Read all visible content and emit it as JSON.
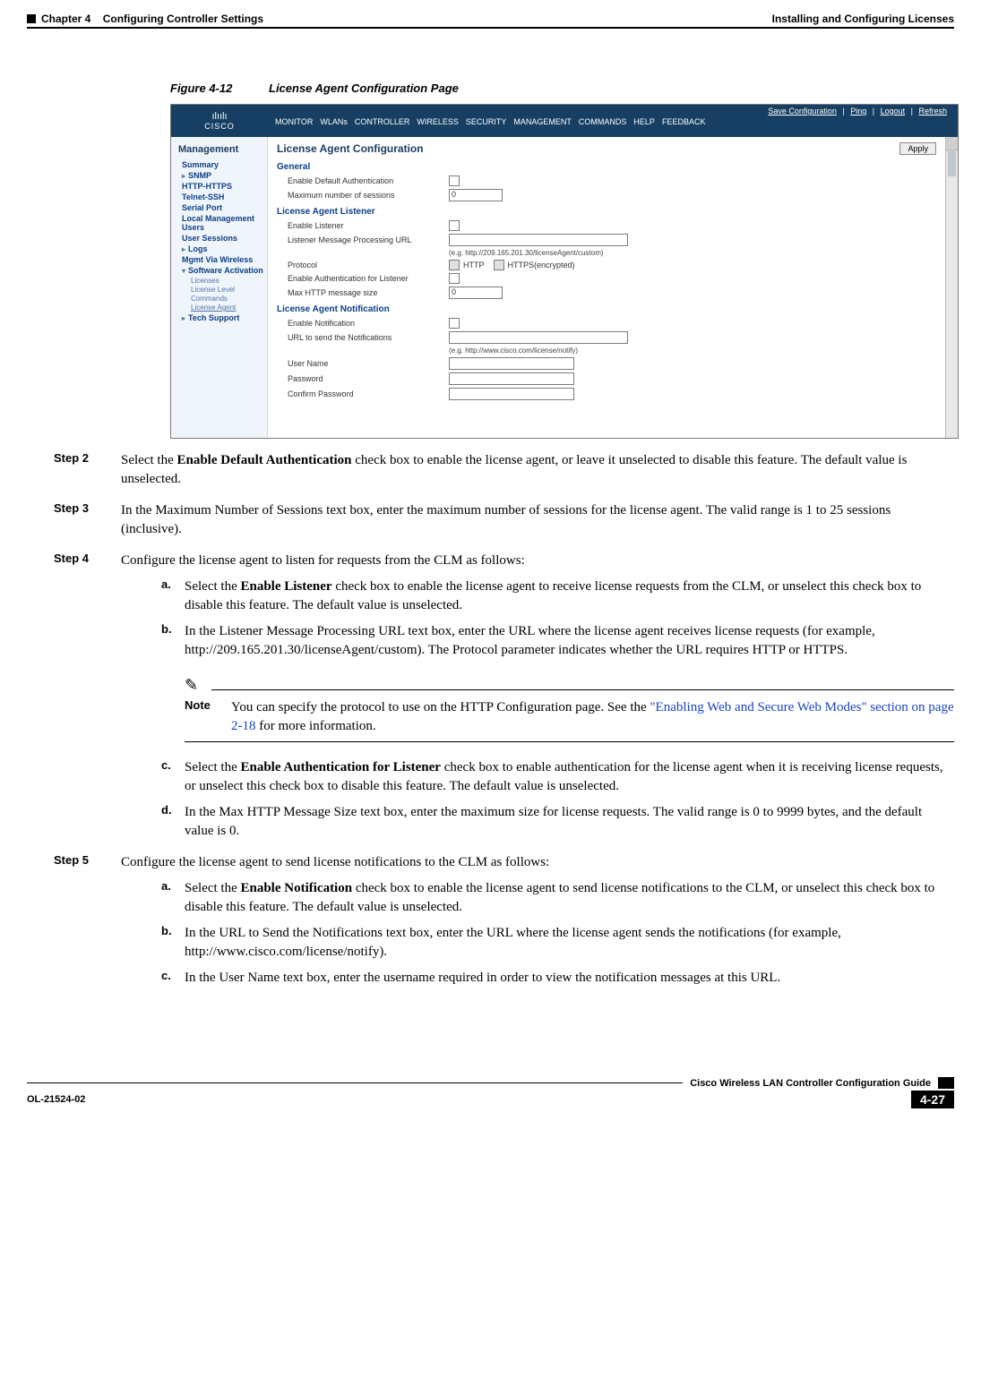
{
  "header": {
    "chapter": "Chapter 4",
    "title": "Configuring Controller Settings",
    "section": "Installing and Configuring Licenses"
  },
  "figure": {
    "num": "Figure 4-12",
    "title": "License Agent Configuration Page"
  },
  "screenshot": {
    "logo_brand": "CISCO",
    "logo_bars": "ılıılı",
    "top_links": {
      "save": "Save Configuration",
      "ping": "Ping",
      "logout": "Logout",
      "refresh": "Refresh"
    },
    "menu": [
      "MONITOR",
      "WLANs",
      "CONTROLLER",
      "WIRELESS",
      "SECURITY",
      "MANAGEMENT",
      "COMMANDS",
      "HELP",
      "FEEDBACK"
    ],
    "sidebar": {
      "heading": "Management",
      "items": [
        {
          "label": "Summary",
          "type": "plain"
        },
        {
          "label": "SNMP",
          "type": "arrow"
        },
        {
          "label": "HTTP-HTTPS",
          "type": "plain"
        },
        {
          "label": "Telnet-SSH",
          "type": "plain"
        },
        {
          "label": "Serial Port",
          "type": "plain"
        },
        {
          "label": "Local Management Users",
          "type": "plain"
        },
        {
          "label": "User Sessions",
          "type": "plain"
        },
        {
          "label": "Logs",
          "type": "arrow"
        },
        {
          "label": "Mgmt Via Wireless",
          "type": "plain"
        },
        {
          "label": "Software Activation",
          "type": "open"
        },
        {
          "label": "Tech Support",
          "type": "arrow"
        }
      ],
      "subitems": [
        "Licenses",
        "License Level",
        "Commands",
        "License Agent"
      ]
    },
    "main": {
      "title": "License Agent Configuration",
      "apply": "Apply",
      "sec1": "General",
      "r1": "Enable Default Authentication",
      "r2": "Maximum number of sessions",
      "r2v": "0",
      "sec2": "License Agent Listener",
      "r3": "Enable Listener",
      "r4": "Listener Message Processing URL",
      "r4hint": "(e.g. http://209.165.201.30/licenseAgent/custom)",
      "r5": "Protocol",
      "r5a": "HTTP",
      "r5b": "HTTPS(encrypted)",
      "r6": "Enable Authentication for Listener",
      "r7": "Max HTTP message size",
      "r7v": "0",
      "sec3": "License Agent Notification",
      "r8": "Enable Notification",
      "r9": "URL to send the Notifications",
      "r9hint": "(e.g. http://www.cisco.com/license/notify)",
      "r10": "User Name",
      "r11": "Password",
      "r12": "Confirm Password"
    }
  },
  "steps": {
    "s2": {
      "num": "Step 2",
      "text_a": "Select the ",
      "text_b": "Enable Default Authentication",
      "text_c": " check box to enable the license agent, or leave it unselected to disable this feature. The default value is unselected."
    },
    "s3": {
      "num": "Step 3",
      "text": "In the Maximum Number of Sessions text box, enter the maximum number of sessions for the license agent. The valid range is 1 to 25 sessions (inclusive)."
    },
    "s4": {
      "num": "Step 4",
      "text": "Configure the license agent to listen for requests from the CLM as follows:"
    },
    "s4a": {
      "l": "a.",
      "t1": "Select the ",
      "b": "Enable Listener",
      "t2": " check box to enable the license agent to receive license requests from the CLM, or unselect this check box to disable this feature. The default value is unselected."
    },
    "s4b": {
      "l": "b.",
      "t": "In the Listener Message Processing URL text box, enter the URL where the license agent receives license requests (for example, http://209.165.201.30/licenseAgent/custom). The Protocol parameter indicates whether the URL requires HTTP or HTTPS."
    },
    "note": {
      "label": "Note",
      "t1": "You can specify the protocol to use on the HTTP Configuration page. See the ",
      "link": "\"Enabling Web and Secure Web Modes\" section on page 2-18",
      "t2": " for more information."
    },
    "s4c": {
      "l": "c.",
      "t1": "Select the ",
      "b": "Enable Authentication for Listener",
      "t2": " check box to enable authentication for the license agent when it is receiving license requests, or unselect this check box to disable this feature. The default value is unselected."
    },
    "s4d": {
      "l": "d.",
      "t": "In the Max HTTP Message Size text box, enter the maximum size for license requests. The valid range is 0 to 9999 bytes, and the default value is 0."
    },
    "s5": {
      "num": "Step 5",
      "text": "Configure the license agent to send license notifications to the CLM as follows:"
    },
    "s5a": {
      "l": "a.",
      "t1": "Select the ",
      "b": "Enable Notification",
      "t2": " check box to enable the license agent to send license notifications to the CLM, or unselect this check box to disable this feature. The default value is unselected."
    },
    "s5b": {
      "l": "b.",
      "t": "In the URL to Send the Notifications text box, enter the URL where the license agent sends the notifications (for example, http://www.cisco.com/license/notify)."
    },
    "s5c": {
      "l": "c.",
      "t": "In the User Name text box, enter the username required in order to view the notification messages at this URL."
    }
  },
  "footer": {
    "guide": "Cisco Wireless LAN Controller Configuration Guide",
    "ol": "OL-21524-02",
    "page": "4-27"
  }
}
